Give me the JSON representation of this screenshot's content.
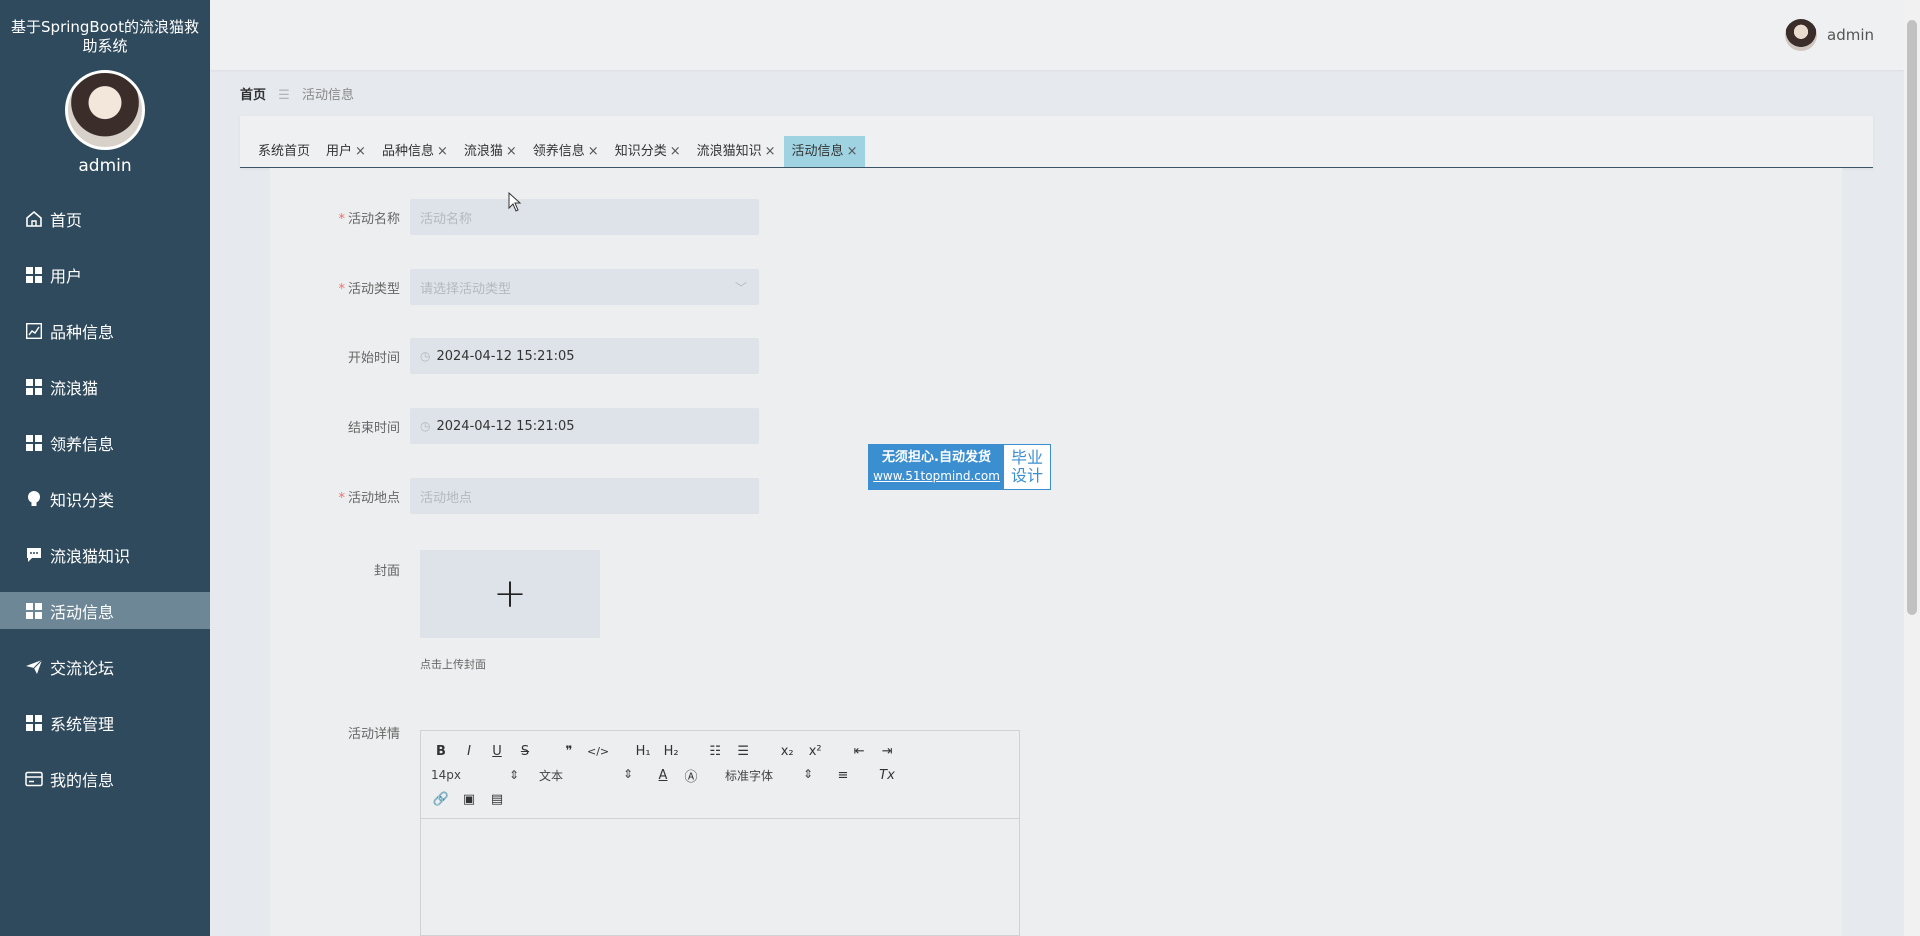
{
  "sidebar": {
    "title": "基于SpringBoot的流浪猫救助系统",
    "username": "admin",
    "items": [
      {
        "label": "首页",
        "icon": "home-icon"
      },
      {
        "label": "用户",
        "icon": "grid-icon"
      },
      {
        "label": "品种信息",
        "icon": "chart-icon"
      },
      {
        "label": "流浪猫",
        "icon": "grid-icon"
      },
      {
        "label": "领养信息",
        "icon": "grid-icon"
      },
      {
        "label": "知识分类",
        "icon": "bulb-icon"
      },
      {
        "label": "流浪猫知识",
        "icon": "chat-icon"
      },
      {
        "label": "活动信息",
        "icon": "grid-icon"
      },
      {
        "label": "交流论坛",
        "icon": "send-icon"
      },
      {
        "label": "系统管理",
        "icon": "grid-icon"
      },
      {
        "label": "我的信息",
        "icon": "card-icon"
      }
    ],
    "active_index": 7
  },
  "header": {
    "username": "admin"
  },
  "breadcrumb": {
    "home": "首页",
    "separator": "☰",
    "current": "活动信息"
  },
  "tabs": [
    {
      "label": "系统首页",
      "closable": false
    },
    {
      "label": "用户",
      "closable": true
    },
    {
      "label": "品种信息",
      "closable": true
    },
    {
      "label": "流浪猫",
      "closable": true
    },
    {
      "label": "领养信息",
      "closable": true
    },
    {
      "label": "知识分类",
      "closable": true
    },
    {
      "label": "流浪猫知识",
      "closable": true
    },
    {
      "label": "活动信息",
      "closable": true,
      "active": true
    }
  ],
  "form": {
    "name": {
      "label": "活动名称",
      "placeholder": "活动名称",
      "required": true
    },
    "type": {
      "label": "活动类型",
      "placeholder": "请选择活动类型",
      "required": true
    },
    "start": {
      "label": "开始时间",
      "value": "2024-04-12 15:21:05"
    },
    "end": {
      "label": "结束时间",
      "value": "2024-04-12 15:21:05"
    },
    "location": {
      "label": "活动地点",
      "placeholder": "活动地点",
      "required": true
    },
    "cover": {
      "label": "封面",
      "hint": "点击上传封面"
    },
    "detail": {
      "label": "活动详情"
    }
  },
  "editor": {
    "row1": [
      "B",
      "I",
      "U",
      "S",
      "❞",
      "</>",
      "H₁",
      "H₂",
      "☷",
      "☰",
      "x₂",
      "x²",
      "⇤",
      "⇥"
    ],
    "font_size": "14px",
    "text_style": "文本",
    "font_family": "标准字体",
    "row2_buttons": [
      "A",
      "Ⓐ",
      "≡",
      "Tx"
    ],
    "row3": [
      "🔗",
      "▣",
      "▤"
    ]
  },
  "watermark": {
    "line1": "无须担心.自动发货",
    "line2": "www.51topmind.com",
    "right1": "毕业",
    "right2": "设计"
  },
  "colors": {
    "sidebar": "#2f4a5c",
    "sidebar_active": "#6e8796",
    "tab_active": "#9fd3e2",
    "required": "#f56c6c",
    "watermark": "#3b8fd0"
  }
}
